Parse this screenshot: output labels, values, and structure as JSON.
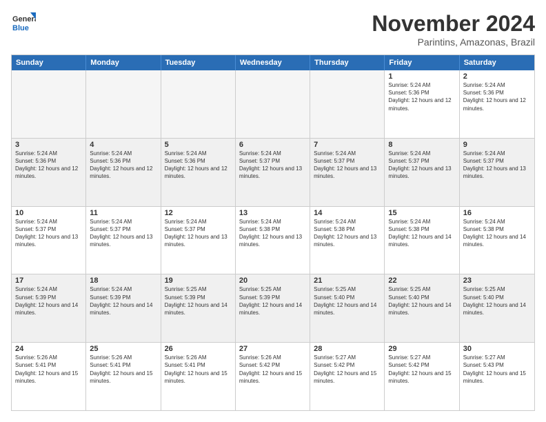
{
  "logo": {
    "line1": "General",
    "line2": "Blue"
  },
  "title": "November 2024",
  "subtitle": "Parintins, Amazonas, Brazil",
  "days_of_week": [
    "Sunday",
    "Monday",
    "Tuesday",
    "Wednesday",
    "Thursday",
    "Friday",
    "Saturday"
  ],
  "weeks": [
    {
      "alt": false,
      "cells": [
        {
          "day": "",
          "empty": true
        },
        {
          "day": "",
          "empty": true
        },
        {
          "day": "",
          "empty": true
        },
        {
          "day": "",
          "empty": true
        },
        {
          "day": "",
          "empty": true
        },
        {
          "day": "1",
          "sunrise": "5:24 AM",
          "sunset": "5:36 PM",
          "daylight": "12 hours and 12 minutes."
        },
        {
          "day": "2",
          "sunrise": "5:24 AM",
          "sunset": "5:36 PM",
          "daylight": "12 hours and 12 minutes."
        }
      ]
    },
    {
      "alt": true,
      "cells": [
        {
          "day": "3",
          "sunrise": "5:24 AM",
          "sunset": "5:36 PM",
          "daylight": "12 hours and 12 minutes."
        },
        {
          "day": "4",
          "sunrise": "5:24 AM",
          "sunset": "5:36 PM",
          "daylight": "12 hours and 12 minutes."
        },
        {
          "day": "5",
          "sunrise": "5:24 AM",
          "sunset": "5:36 PM",
          "daylight": "12 hours and 12 minutes."
        },
        {
          "day": "6",
          "sunrise": "5:24 AM",
          "sunset": "5:37 PM",
          "daylight": "12 hours and 13 minutes."
        },
        {
          "day": "7",
          "sunrise": "5:24 AM",
          "sunset": "5:37 PM",
          "daylight": "12 hours and 13 minutes."
        },
        {
          "day": "8",
          "sunrise": "5:24 AM",
          "sunset": "5:37 PM",
          "daylight": "12 hours and 13 minutes."
        },
        {
          "day": "9",
          "sunrise": "5:24 AM",
          "sunset": "5:37 PM",
          "daylight": "12 hours and 13 minutes."
        }
      ]
    },
    {
      "alt": false,
      "cells": [
        {
          "day": "10",
          "sunrise": "5:24 AM",
          "sunset": "5:37 PM",
          "daylight": "12 hours and 13 minutes."
        },
        {
          "day": "11",
          "sunrise": "5:24 AM",
          "sunset": "5:37 PM",
          "daylight": "12 hours and 13 minutes."
        },
        {
          "day": "12",
          "sunrise": "5:24 AM",
          "sunset": "5:37 PM",
          "daylight": "12 hours and 13 minutes."
        },
        {
          "day": "13",
          "sunrise": "5:24 AM",
          "sunset": "5:38 PM",
          "daylight": "12 hours and 13 minutes."
        },
        {
          "day": "14",
          "sunrise": "5:24 AM",
          "sunset": "5:38 PM",
          "daylight": "12 hours and 13 minutes."
        },
        {
          "day": "15",
          "sunrise": "5:24 AM",
          "sunset": "5:38 PM",
          "daylight": "12 hours and 14 minutes."
        },
        {
          "day": "16",
          "sunrise": "5:24 AM",
          "sunset": "5:38 PM",
          "daylight": "12 hours and 14 minutes."
        }
      ]
    },
    {
      "alt": true,
      "cells": [
        {
          "day": "17",
          "sunrise": "5:24 AM",
          "sunset": "5:39 PM",
          "daylight": "12 hours and 14 minutes."
        },
        {
          "day": "18",
          "sunrise": "5:24 AM",
          "sunset": "5:39 PM",
          "daylight": "12 hours and 14 minutes."
        },
        {
          "day": "19",
          "sunrise": "5:25 AM",
          "sunset": "5:39 PM",
          "daylight": "12 hours and 14 minutes."
        },
        {
          "day": "20",
          "sunrise": "5:25 AM",
          "sunset": "5:39 PM",
          "daylight": "12 hours and 14 minutes."
        },
        {
          "day": "21",
          "sunrise": "5:25 AM",
          "sunset": "5:40 PM",
          "daylight": "12 hours and 14 minutes."
        },
        {
          "day": "22",
          "sunrise": "5:25 AM",
          "sunset": "5:40 PM",
          "daylight": "12 hours and 14 minutes."
        },
        {
          "day": "23",
          "sunrise": "5:25 AM",
          "sunset": "5:40 PM",
          "daylight": "12 hours and 14 minutes."
        }
      ]
    },
    {
      "alt": false,
      "cells": [
        {
          "day": "24",
          "sunrise": "5:26 AM",
          "sunset": "5:41 PM",
          "daylight": "12 hours and 15 minutes."
        },
        {
          "day": "25",
          "sunrise": "5:26 AM",
          "sunset": "5:41 PM",
          "daylight": "12 hours and 15 minutes."
        },
        {
          "day": "26",
          "sunrise": "5:26 AM",
          "sunset": "5:41 PM",
          "daylight": "12 hours and 15 minutes."
        },
        {
          "day": "27",
          "sunrise": "5:26 AM",
          "sunset": "5:42 PM",
          "daylight": "12 hours and 15 minutes."
        },
        {
          "day": "28",
          "sunrise": "5:27 AM",
          "sunset": "5:42 PM",
          "daylight": "12 hours and 15 minutes."
        },
        {
          "day": "29",
          "sunrise": "5:27 AM",
          "sunset": "5:42 PM",
          "daylight": "12 hours and 15 minutes."
        },
        {
          "day": "30",
          "sunrise": "5:27 AM",
          "sunset": "5:43 PM",
          "daylight": "12 hours and 15 minutes."
        }
      ]
    }
  ]
}
